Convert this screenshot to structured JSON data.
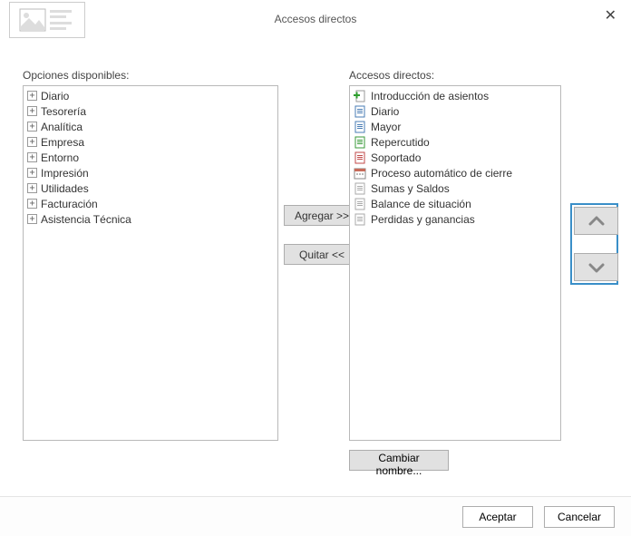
{
  "dialog": {
    "title": "Accesos directos"
  },
  "left": {
    "label": "Opciones disponibles:",
    "items": [
      {
        "label": "Diario"
      },
      {
        "label": "Tesorería"
      },
      {
        "label": "Analítica"
      },
      {
        "label": "Empresa"
      },
      {
        "label": "Entorno"
      },
      {
        "label": "Impresión"
      },
      {
        "label": "Utilidades"
      },
      {
        "label": "Facturación"
      },
      {
        "label": "Asistencia Técnica"
      }
    ]
  },
  "mid": {
    "add": "Agregar >>",
    "remove": "Quitar <<"
  },
  "right": {
    "label": "Accesos directos:",
    "items": [
      {
        "label": "Introducción de asientos",
        "icon": "green-plus"
      },
      {
        "label": "Diario",
        "icon": "doc-blue"
      },
      {
        "label": "Mayor",
        "icon": "doc-blue"
      },
      {
        "label": "Repercutido",
        "icon": "doc-green"
      },
      {
        "label": "Soportado",
        "icon": "doc-red"
      },
      {
        "label": "Proceso automático de cierre",
        "icon": "calendar"
      },
      {
        "label": "Sumas y Saldos",
        "icon": "doc-gray"
      },
      {
        "label": "Balance de situación",
        "icon": "doc-gray"
      },
      {
        "label": "Perdidas y ganancias",
        "icon": "doc-gray"
      }
    ],
    "rename": "Cambiar nombre..."
  },
  "footer": {
    "ok": "Aceptar",
    "cancel": "Cancelar"
  }
}
